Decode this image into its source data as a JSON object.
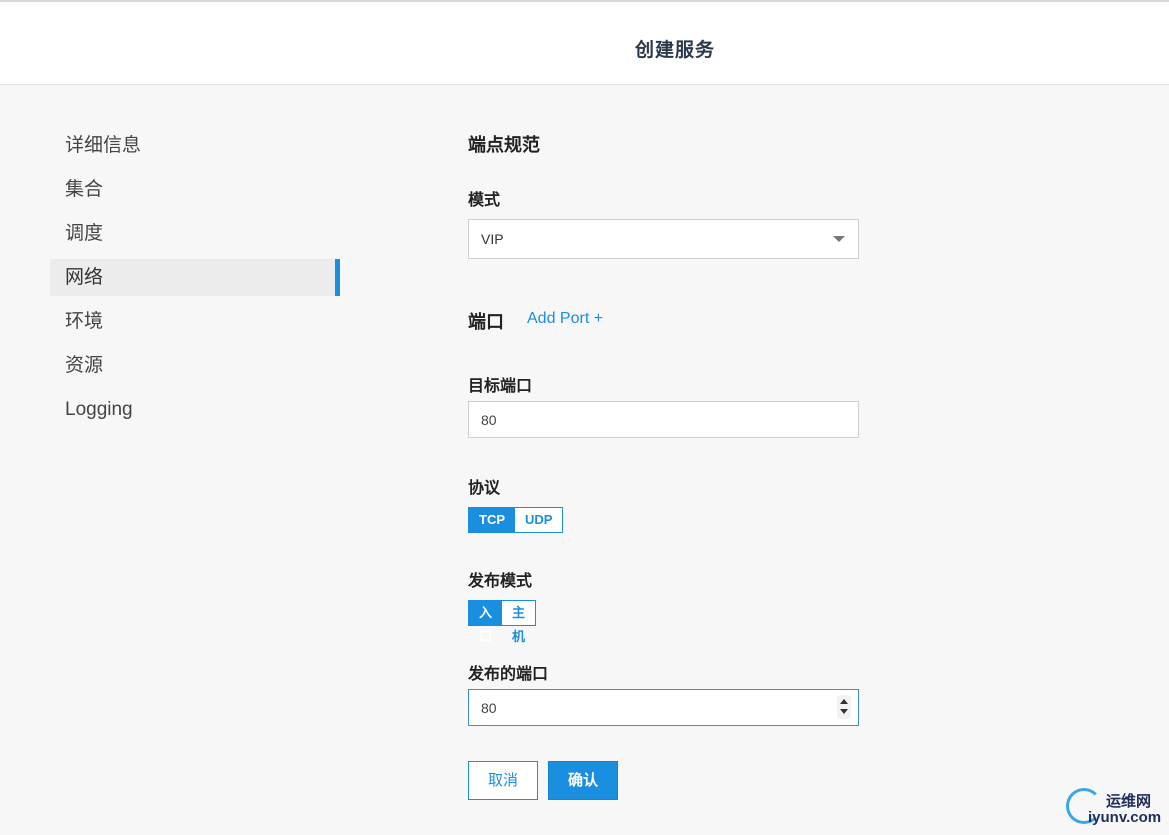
{
  "header": {
    "title": "创建服务"
  },
  "sidebar": {
    "items": [
      {
        "label": "详细信息",
        "active": false
      },
      {
        "label": "集合",
        "active": false
      },
      {
        "label": "调度",
        "active": false
      },
      {
        "label": "网络",
        "active": true
      },
      {
        "label": "环境",
        "active": false
      },
      {
        "label": "资源",
        "active": false
      },
      {
        "label": "Logging",
        "active": false
      }
    ]
  },
  "endpoint": {
    "section_title": "端点规范",
    "mode_label": "模式",
    "mode_value": "VIP"
  },
  "ports": {
    "section_title": "端口",
    "add_port_label": "Add Port +",
    "target_port_label": "目标端口",
    "target_port_value": "80",
    "protocol_label": "协议",
    "protocol_options": [
      "TCP",
      "UDP"
    ],
    "protocol_selected": "TCP",
    "publish_mode_label": "发布模式",
    "publish_mode_options": [
      "入口",
      "主机"
    ],
    "publish_mode_selected": "入口",
    "published_port_label": "发布的端口",
    "published_port_value": "80"
  },
  "actions": {
    "cancel_label": "取消",
    "confirm_label": "确认"
  },
  "watermark": {
    "line1": "运维网",
    "line2": "iyunv.com"
  },
  "colors": {
    "accent": "#1a8fe0",
    "background": "#f7f7f7"
  }
}
